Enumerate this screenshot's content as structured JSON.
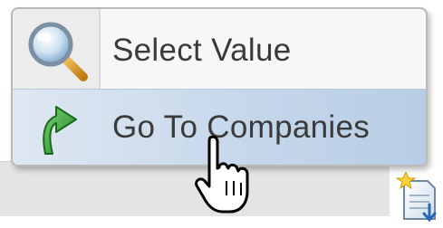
{
  "menu": {
    "items": [
      {
        "label": "Select Value",
        "icon": "magnifier-icon"
      },
      {
        "label": "Go To Companies",
        "icon": "green-arrow-icon"
      }
    ],
    "highlighted_index": 1
  },
  "cursor": {
    "icon": "hand-pointer-icon"
  },
  "corner": {
    "icon": "new-document-icon"
  },
  "colors": {
    "highlight": "#c4d6ea",
    "text": "#3a3a3a",
    "arrow_green": "#2e9d2e"
  }
}
